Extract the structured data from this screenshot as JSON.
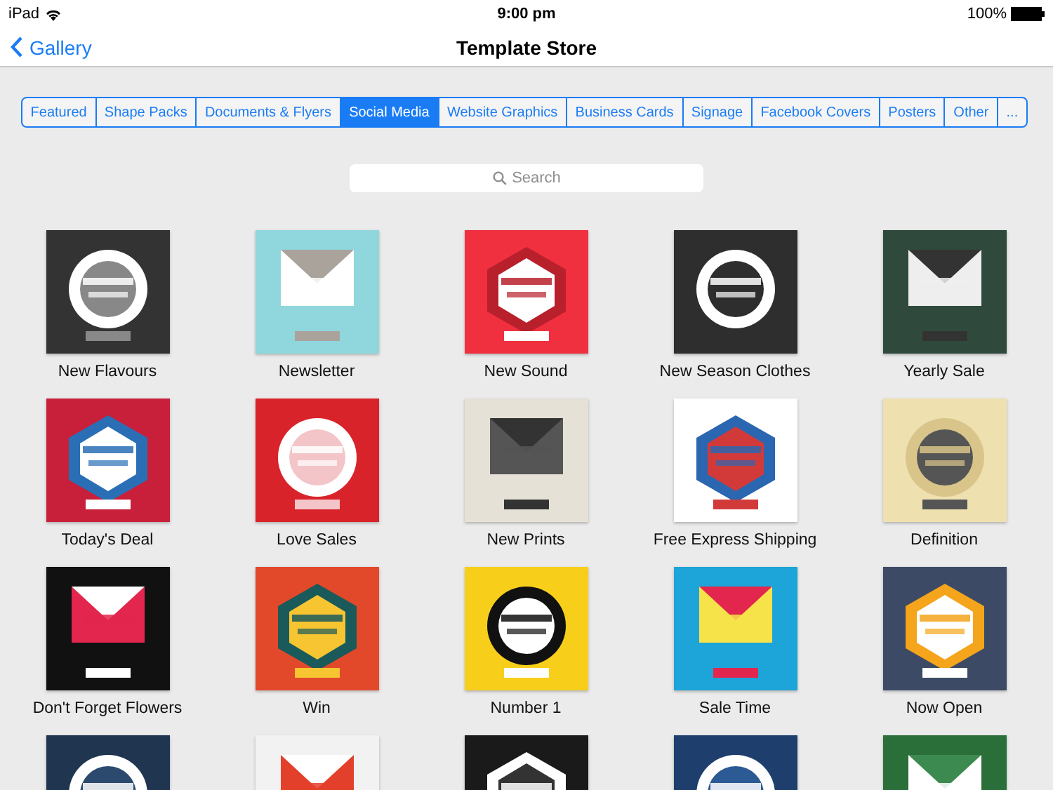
{
  "status_bar": {
    "device": "iPad",
    "time": "9:00 pm",
    "battery": "100%"
  },
  "nav_bar": {
    "back": "Gallery",
    "title": "Template Store"
  },
  "tabs": [
    {
      "label": "Featured",
      "selected": false
    },
    {
      "label": "Shape Packs",
      "selected": false
    },
    {
      "label": "Documents & Flyers",
      "selected": false
    },
    {
      "label": "Social Media",
      "selected": true
    },
    {
      "label": "Website Graphics",
      "selected": false
    },
    {
      "label": "Business Cards",
      "selected": false
    },
    {
      "label": "Signage",
      "selected": false
    },
    {
      "label": "Facebook Covers",
      "selected": false
    },
    {
      "label": "Posters",
      "selected": false
    },
    {
      "label": "Other",
      "selected": false
    },
    {
      "label": "...",
      "selected": false
    }
  ],
  "search": {
    "placeholder": "Search"
  },
  "templates": [
    {
      "title": "New Flavours",
      "kind": "picture"
    },
    {
      "title": "Newsletter",
      "kind": "picture"
    },
    {
      "title": "New Sound",
      "kind": "picture"
    },
    {
      "title": "New Season Clothes",
      "kind": "picture"
    },
    {
      "title": "Yearly Sale",
      "kind": "picture"
    },
    {
      "title": "Today's Deal",
      "kind": "picture"
    },
    {
      "title": "Love Sales",
      "kind": "picture"
    },
    {
      "title": "New Prints",
      "kind": "picture"
    },
    {
      "title": "Free Express Shipping",
      "kind": "picture"
    },
    {
      "title": "Definition",
      "kind": "picture"
    },
    {
      "title": "Don't Forget Flowers",
      "kind": "picture"
    },
    {
      "title": "Win",
      "kind": "picture"
    },
    {
      "title": "Number 1",
      "kind": "picture"
    },
    {
      "title": "Sale Time",
      "kind": "picture"
    },
    {
      "title": "Now Open",
      "kind": "picture"
    },
    {
      "kind": "picture"
    },
    {
      "kind": "picture"
    },
    {
      "kind": "picture"
    },
    {
      "kind": "picture"
    },
    {
      "kind": "picture"
    }
  ]
}
